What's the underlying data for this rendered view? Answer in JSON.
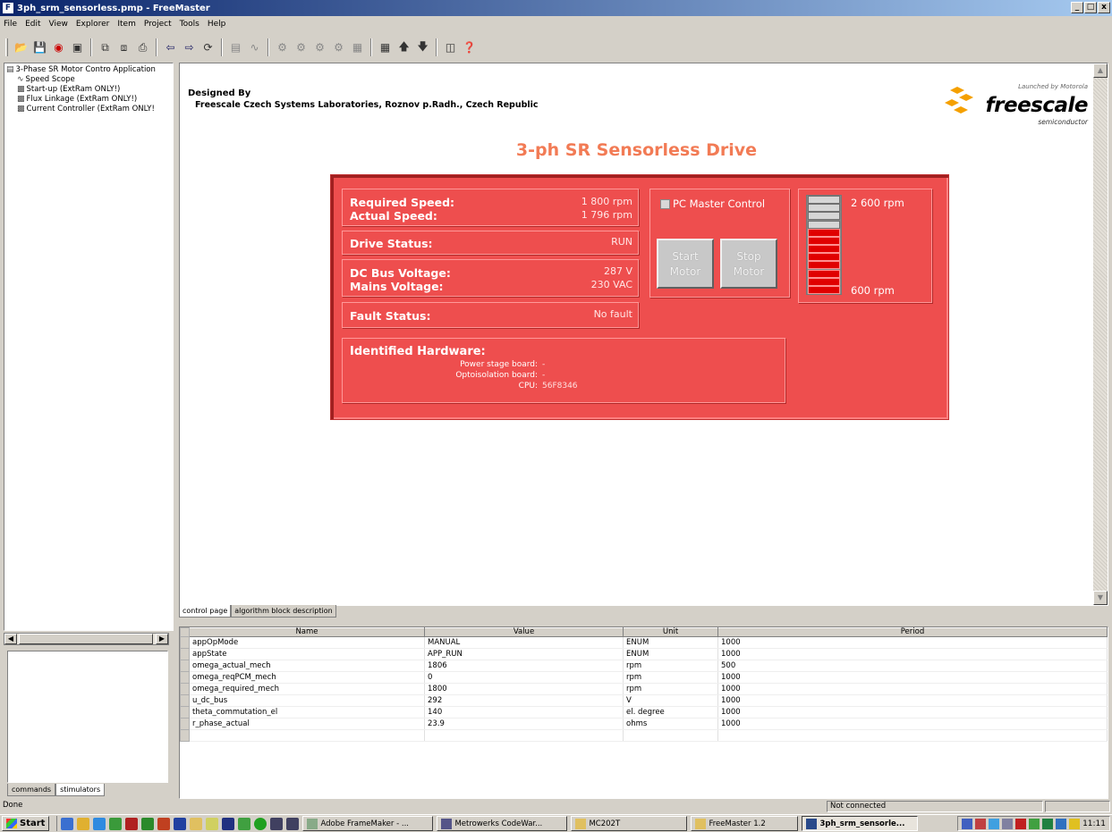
{
  "window": {
    "title": "3ph_srm_sensorless.pmp - FreeMaster",
    "controls": [
      "_",
      "□",
      "x"
    ]
  },
  "menu": [
    "File",
    "Edit",
    "View",
    "Explorer",
    "Item",
    "Project",
    "Tools",
    "Help"
  ],
  "tree": {
    "root": "3-Phase SR Motor Contro Application",
    "items": [
      "Speed Scope",
      "Start-up (ExtRam ONLY!)",
      "Flux Linkage (ExtRam ONLY!)",
      "Current Controller (ExtRam ONLY!"
    ]
  },
  "left_tabs": [
    "commands",
    "stimulators"
  ],
  "page": {
    "designed_by_label": "Designed By",
    "designed_by_org": "Freescale Czech Systems Laboratories, Roznov p.Radh., Czech Republic",
    "logo": {
      "launched": "Launched by Motorola",
      "brand": "freescale",
      "sub": "semiconductor"
    },
    "heading": "3-ph SR Sensorless Drive",
    "panel": {
      "required_speed_label": "Required Speed:",
      "required_speed_value": "1 800 rpm",
      "actual_speed_label": "Actual Speed:",
      "actual_speed_value": "1 796 rpm",
      "drive_status_label": "Drive Status:",
      "drive_status_value": "RUN",
      "dc_bus_label": "DC Bus Voltage:",
      "dc_bus_value": "287 V",
      "mains_label": "Mains Voltage:",
      "mains_value": "230 VAC",
      "fault_label": "Fault Status:",
      "fault_value": "No fault",
      "pc_master_label": "PC Master Control",
      "start_line1": "Start",
      "start_line2": "Motor",
      "stop_line1": "Stop",
      "stop_line2": "Motor",
      "speed_max": "2 600 rpm",
      "speed_min": "600 rpm",
      "speed_bar_lit_segments": 8,
      "speed_bar_total_segments": 12,
      "hw_title": "Identified Hardware:",
      "hw_power_label": "Power stage board:",
      "hw_power_value": "-",
      "hw_opto_label": "Optoisolation board:",
      "hw_opto_value": "-",
      "hw_cpu_label": "CPU:",
      "hw_cpu_value": "56F8346"
    },
    "tabs": [
      "control page",
      "algorithm block description"
    ]
  },
  "watch": {
    "headers": [
      "Name",
      "Value",
      "Unit",
      "Period"
    ],
    "rows": [
      [
        "appOpMode",
        "MANUAL",
        "ENUM",
        "1000"
      ],
      [
        "appState",
        "APP_RUN",
        "ENUM",
        "1000"
      ],
      [
        "omega_actual_mech",
        "1806",
        "rpm",
        "500"
      ],
      [
        "omega_reqPCM_mech",
        "0",
        "rpm",
        "1000"
      ],
      [
        "omega_required_mech",
        "1800",
        "rpm",
        "1000"
      ],
      [
        "u_dc_bus",
        "292",
        "V",
        "1000"
      ],
      [
        "theta_commutation_el",
        "140",
        "el. degree",
        "1000"
      ],
      [
        "r_phase_actual",
        "23.9",
        "ohms",
        "1000"
      ]
    ]
  },
  "status": {
    "left": "Done",
    "connection": "Not connected"
  },
  "taskbar": {
    "start": "Start",
    "tasks": [
      "Adobe FrameMaker - ...",
      "Metrowerks CodeWar...",
      "MC202T",
      "FreeMaster 1.2",
      "3ph_srm_sensorle..."
    ],
    "clock": "11:11"
  },
  "colors": {
    "panel_red": "#ee4e4e",
    "heading_orange": "#f27b55",
    "bar_lit": "#e00000",
    "titlebar": "#0a246a"
  }
}
